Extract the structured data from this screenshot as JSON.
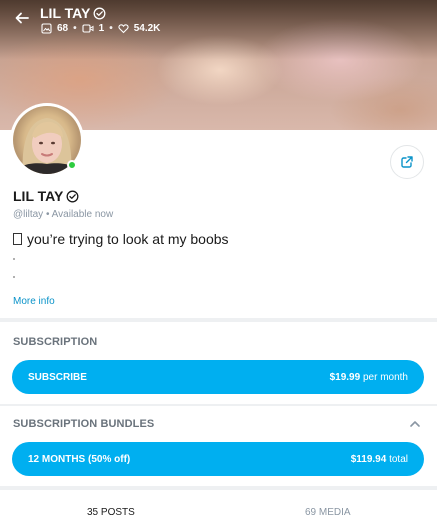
{
  "header": {
    "name": "LIL TAY",
    "stats": {
      "photos": "68",
      "videos": "1",
      "likes": "54.2K"
    }
  },
  "profile": {
    "name": "LIL TAY",
    "handle": "@liltay",
    "status": "Available now",
    "bio": "you’re trying to look at my boobs",
    "more_info": "More info"
  },
  "subscription": {
    "title": "SUBSCRIPTION",
    "button_label": "SUBSCRIBE",
    "price": "$19.99",
    "price_suffix": "per month"
  },
  "bundles": {
    "title": "SUBSCRIPTION BUNDLES",
    "item_label": "12 MONTHS (50% off)",
    "price": "$119.94",
    "price_suffix": "total"
  },
  "tabs": {
    "posts": "35 POSTS",
    "media": "69 MEDIA"
  },
  "colors": {
    "accent": "#00aff0",
    "link": "#0a93c9",
    "online": "#2ecc40"
  }
}
